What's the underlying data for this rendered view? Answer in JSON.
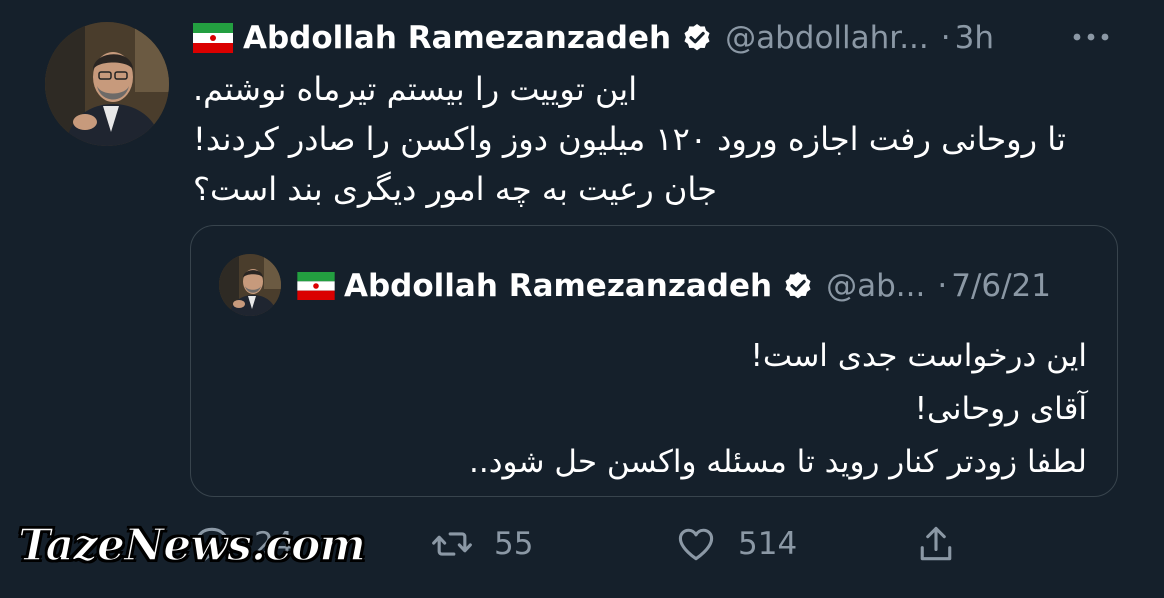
{
  "tweet": {
    "author": {
      "name": "Abdollah Ramezanzadeh",
      "handle": "@abdollahr...",
      "separator": "·",
      "time": "3h"
    },
    "text_lines": [
      "این توییت را بیستم تیرماه نوشتم.",
      "تا روحانی رفت اجازه ورود ۱۲۰ میلیون دوز واکسن را صادر کردند!",
      "جان رعیت به چه امور دیگری بند است؟"
    ],
    "quoted": {
      "author": {
        "name": "Abdollah Ramezanzadeh",
        "handle": "@ab...",
        "separator": "·",
        "date": "7/6/21"
      },
      "text_lines": [
        "این درخواست جدی است!",
        "آقای روحانی!",
        "لطفا زودتر کنار روید تا مسئله واکسن حل شود.."
      ]
    },
    "actions": {
      "reply_count": "24",
      "retweet_count": "55",
      "like_count": "514"
    }
  },
  "watermark": "TazeNews.com",
  "colors": {
    "background": "#15202b",
    "secondary_text": "#8b98a5",
    "border": "#38444d"
  },
  "icons": [
    "iran-flag-icon",
    "verified-badge-icon",
    "more-icon",
    "reply-icon",
    "retweet-icon",
    "like-icon",
    "share-icon"
  ]
}
